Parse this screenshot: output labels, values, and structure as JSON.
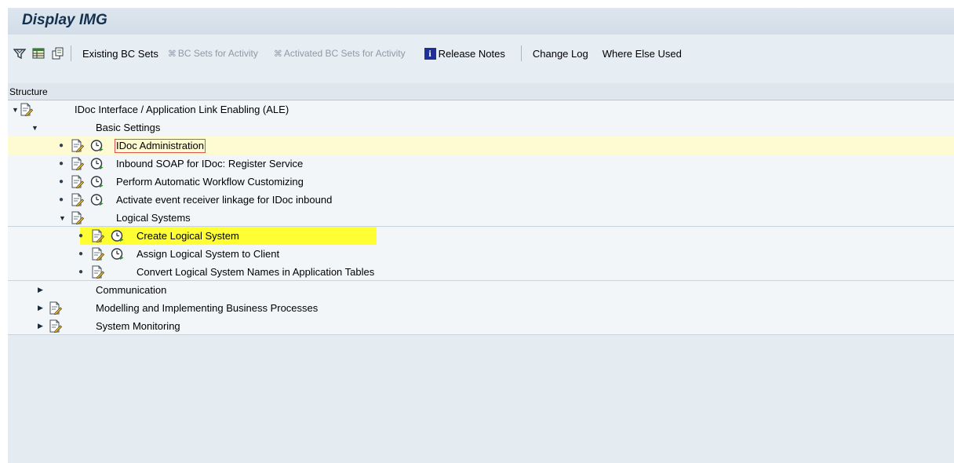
{
  "window": {
    "title": "Display IMG"
  },
  "toolbar": {
    "icons": [
      "filter-icon",
      "table-icon",
      "copy-icon"
    ],
    "existing_bc_sets": "Existing BC Sets",
    "bc_sets_for_activity": "BC Sets for Activity",
    "activated_bc_sets": "Activated BC Sets for Activity",
    "release_notes": "Release Notes",
    "change_log": "Change Log",
    "where_else_used": "Where Else Used"
  },
  "structure": {
    "header": "Structure",
    "nodes": [
      {
        "label": "IDoc Interface / Application Link Enabling (ALE)",
        "level": 0,
        "expanded": true,
        "doc_icon": true
      },
      {
        "label": "Basic Settings",
        "level": 1,
        "expanded": true
      },
      {
        "label": "IDoc Administration",
        "level": 2,
        "leaf": true,
        "execute_icon": true,
        "selected": true
      },
      {
        "label": "Inbound SOAP for IDoc: Register Service",
        "level": 2,
        "leaf": true,
        "execute_icon": true
      },
      {
        "label": "Perform Automatic Workflow Customizing",
        "level": 2,
        "leaf": true,
        "execute_icon": true
      },
      {
        "label": "Activate event receiver linkage for IDoc inbound",
        "level": 2,
        "leaf": true,
        "execute_icon": true
      },
      {
        "label": "Logical Systems",
        "level": 2,
        "expanded": true
      },
      {
        "label": "Create Logical System",
        "level": 3,
        "leaf": true,
        "execute_icon": true,
        "highlighted": true
      },
      {
        "label": "Assign Logical System to Client",
        "level": 3,
        "leaf": true,
        "execute_icon": true
      },
      {
        "label": "Convert Logical System Names in Application Tables",
        "level": 3,
        "leaf": true,
        "execute_icon": false
      },
      {
        "label": "Communication",
        "level": 1,
        "expanded": false
      },
      {
        "label": "Modelling and Implementing Business Processes",
        "level": 1,
        "expanded": false,
        "doc_icon": true
      },
      {
        "label": "System Monitoring",
        "level": 1,
        "expanded": false,
        "doc_icon": true
      }
    ]
  },
  "colors": {
    "selected_row": "#fefbd2",
    "highlight": "#ffff33",
    "focus_border": "#e05050",
    "title": "#13304e"
  }
}
